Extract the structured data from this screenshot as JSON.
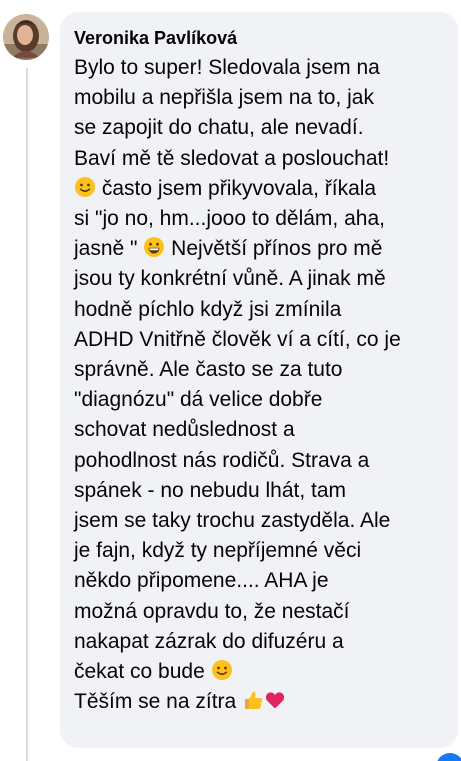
{
  "comment": {
    "author": "Veronika Pavlíková",
    "lines": [
      "Bylo to super! Sledovala jsem na",
      "mobilu a nepřišla jsem na to, jak",
      "se zapojit do chatu, ale nevadí.",
      "Baví mě tě sledovat a poslouchat!",
      " často jsem přikyvovala, říkala",
      "si \"jo no, hm...jooo to dělám, aha,",
      "jasně \"",
      " Největší přínos pro mě",
      "jsou ty konkrétní vůně. A jinak mě",
      "hodně píchlo když jsi zmínila",
      "ADHD Vnitřně člověk ví a cítí, co je",
      "správně. Ale často se za tuto",
      "\"diagnózu\" dá velice dobře",
      "schovat nedůslednost a",
      "pohodlnost nás rodičů. Strava a",
      "spánek - no nebudu lhát, tam",
      "jsem se taky trochu zastyděla. Ale",
      "je fajn, když ty nepříjemné věci",
      "někdo připomene.... AHA je",
      "možná opravdu to, že nestačí",
      "nakapat zázrak do difuzéru a",
      "čekat co bude",
      "Těším se na zítra"
    ],
    "emoji": {
      "smile": "slightly-smiling-face",
      "grin": "grinning-face",
      "thumb": "thumbs-up",
      "heart": "red-heart"
    }
  },
  "colors": {
    "bubble": "#f0f2f5",
    "text": "#050505",
    "thread_line": "#d7dadf",
    "accent": "#1877f2"
  }
}
